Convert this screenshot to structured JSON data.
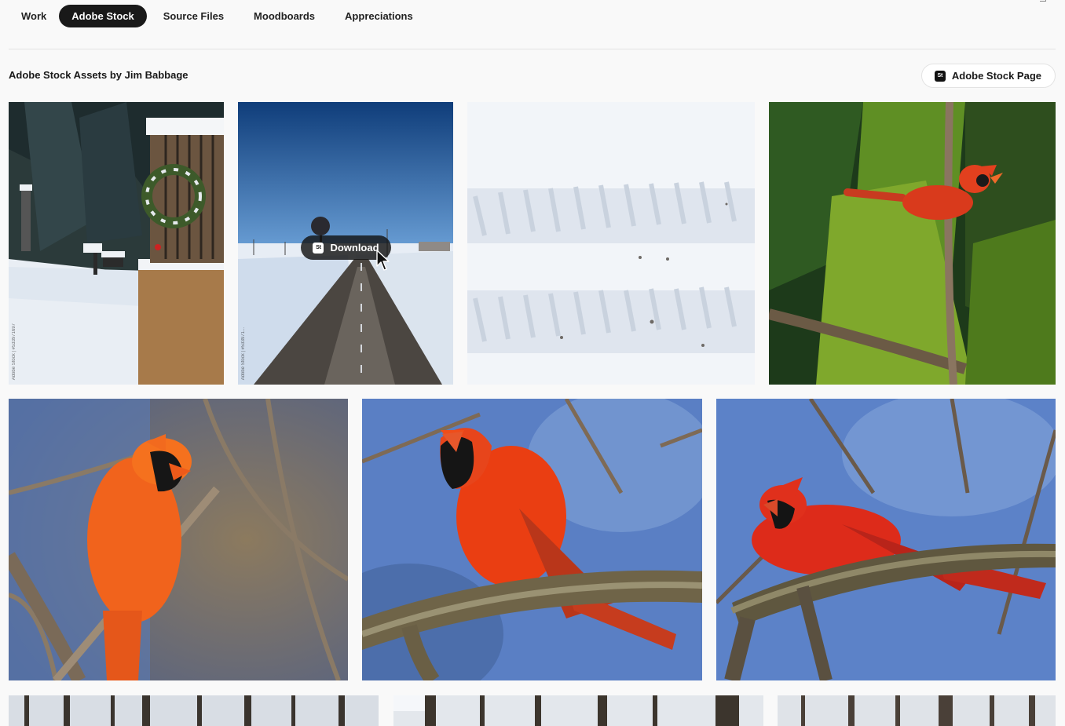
{
  "tabs": [
    {
      "label": "Work",
      "active": false
    },
    {
      "label": "Adobe Stock",
      "active": true
    },
    {
      "label": "Source Files",
      "active": false
    },
    {
      "label": "Moodboards",
      "active": false
    },
    {
      "label": "Appreciations",
      "active": false
    }
  ],
  "section": {
    "title": "Adobe Stock Assets by Jim Babbage",
    "stock_page_button": "Adobe Stock Page",
    "badge_text": "St"
  },
  "hover_overlay": {
    "download_label": "Download",
    "badge_text": "St"
  },
  "assets": [
    {
      "subject": "snowy garden with wreath and bench",
      "id_text": "Adobe Stock | #533971697"
    },
    {
      "subject": "snowy country road under blue sky",
      "id_text": "Adobe Stock | #533971..."
    },
    {
      "subject": "tire tracks in snow"
    },
    {
      "subject": "northern cardinal in evergreen"
    },
    {
      "subject": "cardinal perched on branch facing right"
    },
    {
      "subject": "cardinal on mossy branch facing left"
    },
    {
      "subject": "cardinal leaning on branch"
    },
    {
      "subject": "snowy forest treeline"
    },
    {
      "subject": "snowy forest trees"
    },
    {
      "subject": "snowy forest winter"
    }
  ],
  "colors": {
    "active_tab_bg": "#191919",
    "page_bg": "#f9f9f9",
    "cardinal_red": "#e8321e",
    "sky_blue": "#3f6eb5"
  }
}
